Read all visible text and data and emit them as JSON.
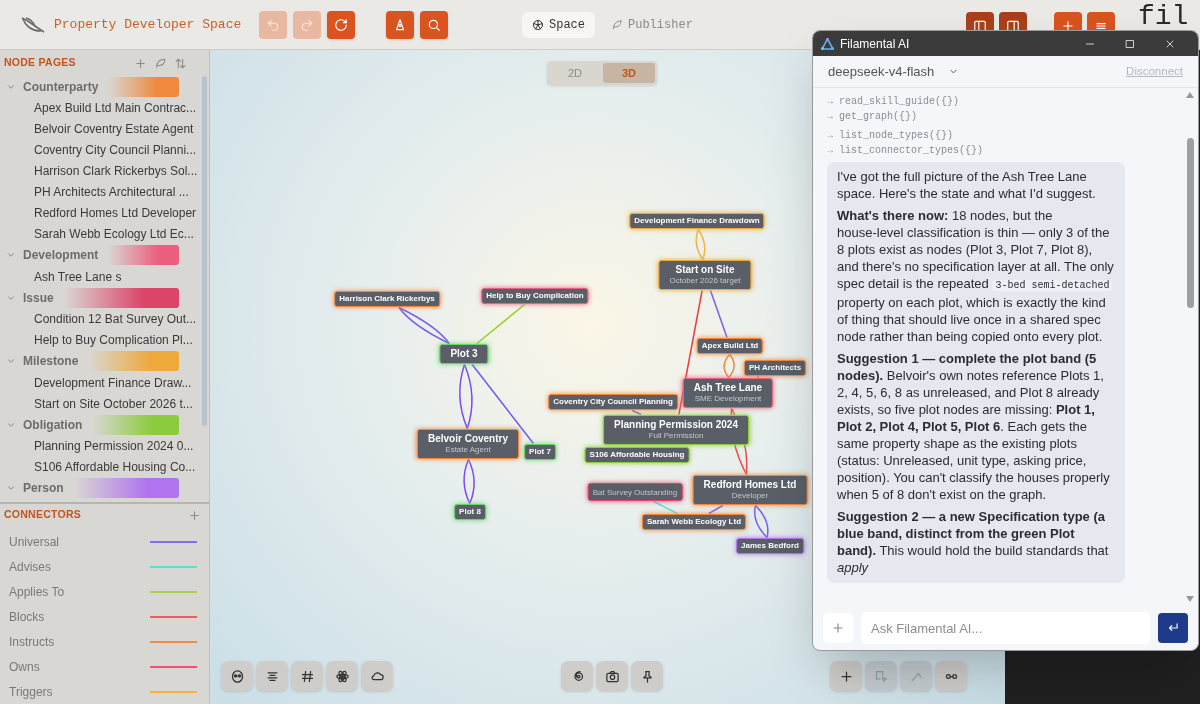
{
  "app": {
    "title": "Property Developer Space",
    "brand_text": "fil"
  },
  "toolbar": [
    {
      "kind": "undo",
      "disabled": true
    },
    {
      "kind": "redo",
      "disabled": true
    },
    {
      "kind": "refresh",
      "disabled": false
    },
    {
      "kind": "pen",
      "disabled": false
    },
    {
      "kind": "search",
      "disabled": false
    }
  ],
  "view_tabs": [
    {
      "label": "Space",
      "kind": "space",
      "selected": true
    },
    {
      "label": "Publisher",
      "kind": "publisher",
      "selected": false
    }
  ],
  "panel_buttons": [
    {
      "kind": "left-panel"
    },
    {
      "kind": "right-panel"
    },
    {
      "kind": "add"
    },
    {
      "kind": "menu"
    }
  ],
  "dimension_toggle": [
    {
      "label": "2D",
      "selected": false
    },
    {
      "label": "3D",
      "selected": true
    }
  ],
  "sidebar": {
    "node_pages": {
      "title": "NODE PAGES",
      "groups": [
        {
          "label": "Counterparty",
          "color": "#f0883e",
          "expanded": true,
          "children": [
            {
              "label": "Apex Build Ltd Main Contrac..."
            },
            {
              "label": "Belvoir Coventry Estate Agent"
            },
            {
              "label": "Coventry City Council Planni..."
            },
            {
              "label": "Harrison Clark Rickerbys Sol..."
            },
            {
              "label": "PH Architects Architectural ..."
            },
            {
              "label": "Redford Homes Ltd Developer"
            },
            {
              "label": "Sarah Webb Ecology Ltd Ec..."
            }
          ]
        },
        {
          "label": "Development",
          "color": "#ec5f7f",
          "expanded": true,
          "children": [
            {
              "label": "Ash Tree Lane s"
            }
          ]
        },
        {
          "label": "Issue",
          "color": "#dc4468",
          "expanded": true,
          "children": [
            {
              "label": "Condition 12 Bat Survey Out..."
            },
            {
              "label": "Help to Buy Complication Pl..."
            }
          ]
        },
        {
          "label": "Milestone",
          "color": "#eda93a",
          "expanded": true,
          "children": [
            {
              "label": "Development Finance Draw..."
            },
            {
              "label": "Start on Site October 2026 t..."
            }
          ]
        },
        {
          "label": "Obligation",
          "color": "#8ccc3c",
          "expanded": true,
          "children": [
            {
              "label": "Planning Permission 2024 0..."
            },
            {
              "label": "S106 Affordable Housing Co..."
            }
          ]
        },
        {
          "label": "Person",
          "color": "#b074ee",
          "expanded": true
        }
      ]
    },
    "connectors": {
      "title": "CONNECTORS",
      "items": [
        {
          "label": "Universal",
          "color": "#8b6cf0"
        },
        {
          "label": "Advises",
          "color": "#5ee0d0"
        },
        {
          "label": "Applies To",
          "color": "#a8d448"
        },
        {
          "label": "Blocks",
          "color": "#ef5b5b"
        },
        {
          "label": "Instructs",
          "color": "#f08c4a"
        },
        {
          "label": "Owns",
          "color": "#ec5470"
        },
        {
          "label": "Triggers",
          "color": "#f2b43c"
        }
      ]
    }
  },
  "graph": {
    "nodes": [
      {
        "title": "Harrison Clark Rickerbys",
        "color": "#f0883e"
      },
      {
        "title": "Help to Buy Complication",
        "color": "#ec5f7f"
      },
      {
        "title": "Plot 3",
        "color": "#6ad66a"
      },
      {
        "title": "Belvoir Coventry",
        "subtitle": "Estate Agent",
        "color": "#f0883e"
      },
      {
        "title": "Plot 7",
        "color": "#6ad66a"
      },
      {
        "title": "Plot 8",
        "color": "#6ad66a"
      },
      {
        "title": "Development Finance Drawdown",
        "color": "#eda93a"
      },
      {
        "title": "Start on Site",
        "subtitle": "October 2026 target",
        "color": "#eda93a"
      },
      {
        "title": "Apex Build Ltd",
        "color": "#f0883e"
      },
      {
        "title": "Ash Tree Lane",
        "subtitle": "SME Development",
        "color": "#ec5f7f"
      },
      {
        "title": "PH Architects",
        "color": "#f0883e"
      },
      {
        "title": "Coventry City Council Planning",
        "color": "#f0883e"
      },
      {
        "title": "Planning Permission 2024",
        "subtitle": "Full Permission",
        "color": "#8ccc3c"
      },
      {
        "title": "S106 Affordable Housing",
        "color": "#8ccc3c"
      },
      {
        "subtitle": "Bat Survey Outstanding",
        "color": "#dc4468"
      },
      {
        "title": "Redford Homes Ltd",
        "subtitle": "Developer",
        "color": "#f0883e"
      },
      {
        "title": "Sarah Webb Ecology Ltd",
        "color": "#f0883e"
      },
      {
        "title": "James Bedford",
        "color": "#b074ee"
      }
    ]
  },
  "bottom_tools": {
    "left": [
      {
        "kind": "mask"
      },
      {
        "kind": "align"
      },
      {
        "kind": "hash"
      },
      {
        "kind": "atom"
      },
      {
        "kind": "cloud"
      }
    ],
    "center": [
      {
        "kind": "spiral"
      },
      {
        "kind": "camera"
      },
      {
        "kind": "pin"
      }
    ],
    "right": [
      {
        "kind": "add",
        "disabled": false
      },
      {
        "kind": "select",
        "disabled": true
      },
      {
        "kind": "line",
        "disabled": true
      },
      {
        "kind": "link",
        "disabled": false
      }
    ]
  },
  "chat": {
    "title": "Filamental AI",
    "model": "deepseek-v4-flash",
    "disconnect": "Disconnect",
    "tool_calls": [
      [
        "→ read_skill_guide({})",
        "→ get_graph({})"
      ],
      [
        "→ list_node_types({})",
        "→ list_connector_types({})"
      ]
    ],
    "message": [
      "I've got the full picture of the Ash Tree Lane space. Here's the state and what I'd suggest.",
      [
        {
          "text": "**What's there now:** 18 nodes, but the house-level classification is thin — only 3 of the 8 plots exist as nodes (Plot 3, Plot 7, Plot 8), and there's no specification layer at all. The only spec detail is the repeated "
        },
        {
          "text": "3-bed semi-detached",
          "kind": "code"
        },
        {
          "text": " property on each plot, which is exactly the kind of thing that should live once in a shared spec node rather than being copied onto every plot."
        }
      ],
      "**Suggestion 1 — complete the plot band (5 nodes).** Belvoir's own notes reference Plots 1, 2, 4, 5, 6, 8 as unreleased, and Plot 8 already exists, so five plot nodes are missing: **Plot 1, Plot 2, Plot 4, Plot 5, Plot 6**. Each gets the same property shape as the existing plots (status: Unreleased, unit type, asking price, position). You can't classify the houses properly when 5 of 8 don't exist on the graph.",
      "**Suggestion 2 — a new Specification type (a blue band, distinct from the green Plot band).** This would hold the build standards that *apply*"
    ],
    "input_placeholder": "Ask Filamental AI..."
  }
}
